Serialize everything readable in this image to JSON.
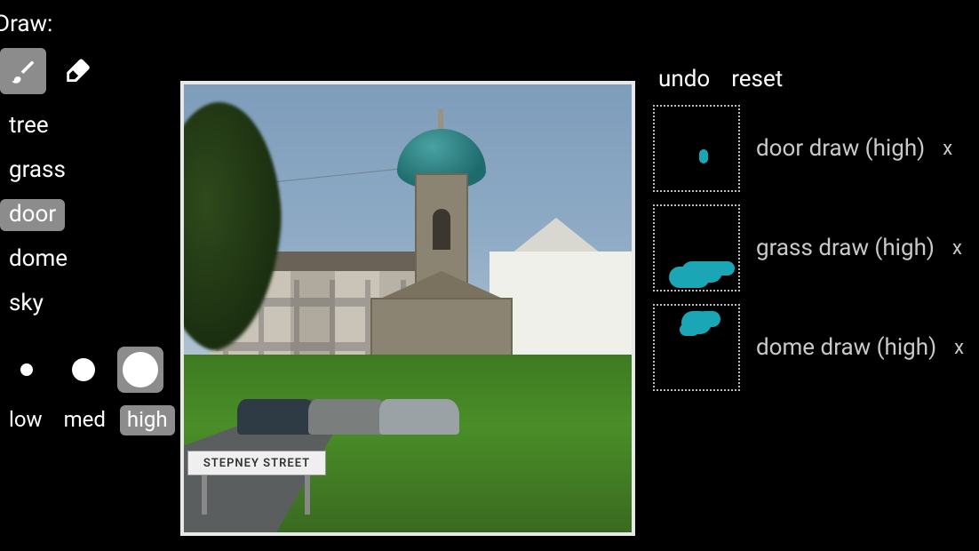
{
  "left": {
    "title": "Draw:",
    "tools": {
      "brush_selected": true,
      "eraser_selected": false
    },
    "categories": [
      {
        "label": "tree",
        "selected": false
      },
      {
        "label": "grass",
        "selected": false
      },
      {
        "label": "door",
        "selected": true
      },
      {
        "label": "dome",
        "selected": false
      },
      {
        "label": "sky",
        "selected": false
      }
    ],
    "brush_sizes": [
      {
        "size": "small",
        "selected": false
      },
      {
        "size": "medium",
        "selected": false
      },
      {
        "size": "large",
        "selected": true
      }
    ],
    "levels": [
      {
        "label": "low",
        "selected": false
      },
      {
        "label": "med",
        "selected": false
      },
      {
        "label": "high",
        "selected": true
      }
    ]
  },
  "canvas": {
    "sign_text": "STEPNEY STREET"
  },
  "right": {
    "undo_label": "undo",
    "reset_label": "reset",
    "history": [
      {
        "label": "door draw (high)",
        "close": "x",
        "stroke_css": "left:50px;top:48px;width:10px;height:16px;border-radius:5px"
      },
      {
        "label": "grass draw (high)",
        "close": "x",
        "stroke_css": "left:30px;top:62px;width:46px;height:24px;border-radius:14px;box-shadow:-14px 6px 0 0 #1aa6b5,18px -4px 0 -4px #1aa6b5"
      },
      {
        "label": "dome draw (high)",
        "close": "x",
        "stroke_css": "left:30px;top:6px;width:34px;height:26px;border-radius:14px;box-shadow:14px -4px 0 -4px #1aa6b5,-8px 8px 0 -6px #1aa6b5"
      }
    ]
  },
  "colors": {
    "accent": "#1aa6b5",
    "selected_bg": "#8c8c8c"
  }
}
